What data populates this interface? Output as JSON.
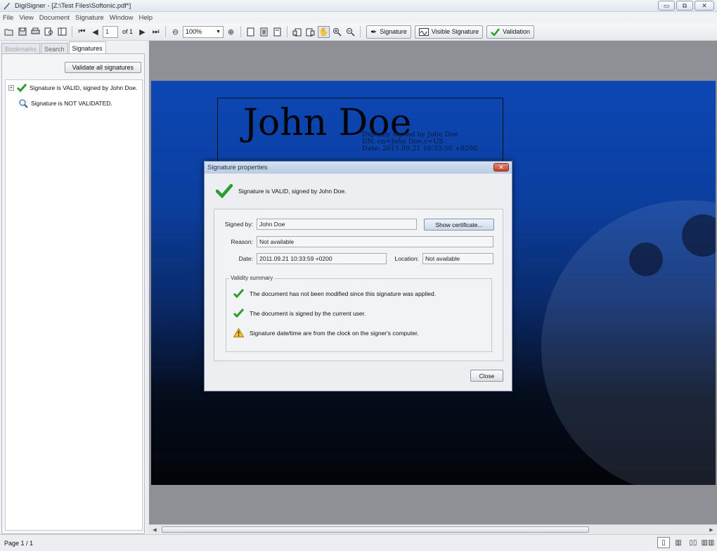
{
  "window": {
    "title": "DigiSigner - [Z:\\Test Files\\Softonic.pdf*]",
    "minimize": "▭",
    "maximize": "⧉",
    "close": "✕"
  },
  "menu": [
    "File",
    "View",
    "Document",
    "Signature",
    "Window",
    "Help"
  ],
  "toolbar": {
    "page_value": "1",
    "page_of": "of 1",
    "zoom_value": "100%",
    "signature_label": "Signature",
    "visible_signature_label": "Visible Signature",
    "validation_label": "Validation"
  },
  "left_panel": {
    "tabs": [
      "Bookmarks",
      "Search",
      "Signatures"
    ],
    "validate_all_label": "Validate all signatures",
    "signatures": [
      {
        "text": "Signature is VALID, signed by John Doe.",
        "status": "valid"
      },
      {
        "text": "Signature is NOT VALIDATED.",
        "status": "not-validated"
      }
    ]
  },
  "document": {
    "signature_name": "John Doe",
    "details": [
      "Digitally signed by John Doe",
      "DN: cn=John Doe,c=US",
      "Date: 2011.09.21 10:33:50 +0200"
    ]
  },
  "dialog": {
    "title": "Signature properties",
    "status_text": "Signature is VALID, signed by John Doe.",
    "signed_by_label": "Signed by:",
    "signed_by_value": "John Doe",
    "show_certificate_label": "Show certificate...",
    "reason_label": "Reason:",
    "reason_value": "Not available",
    "date_label": "Date:",
    "date_value": "2011.09.21 10:33:59 +0200",
    "location_label": "Location:",
    "location_value": "Not available",
    "validity_title": "Validity summary",
    "validity_items": [
      {
        "text": "The document has not been modified since this signature was applied.",
        "icon": "check-icon"
      },
      {
        "text": "The document is signed by the current user.",
        "icon": "check-icon"
      },
      {
        "text": "Signature date/time are from the clock on the signer's computer.",
        "icon": "warning-icon"
      }
    ],
    "close_label": "Close"
  },
  "status_bar": {
    "page_text": "Page 1 / 1"
  },
  "colors": {
    "valid_green": "#2a9d2a",
    "page_blue": "#0d47b5",
    "warning_yellow": "#f2c230"
  }
}
